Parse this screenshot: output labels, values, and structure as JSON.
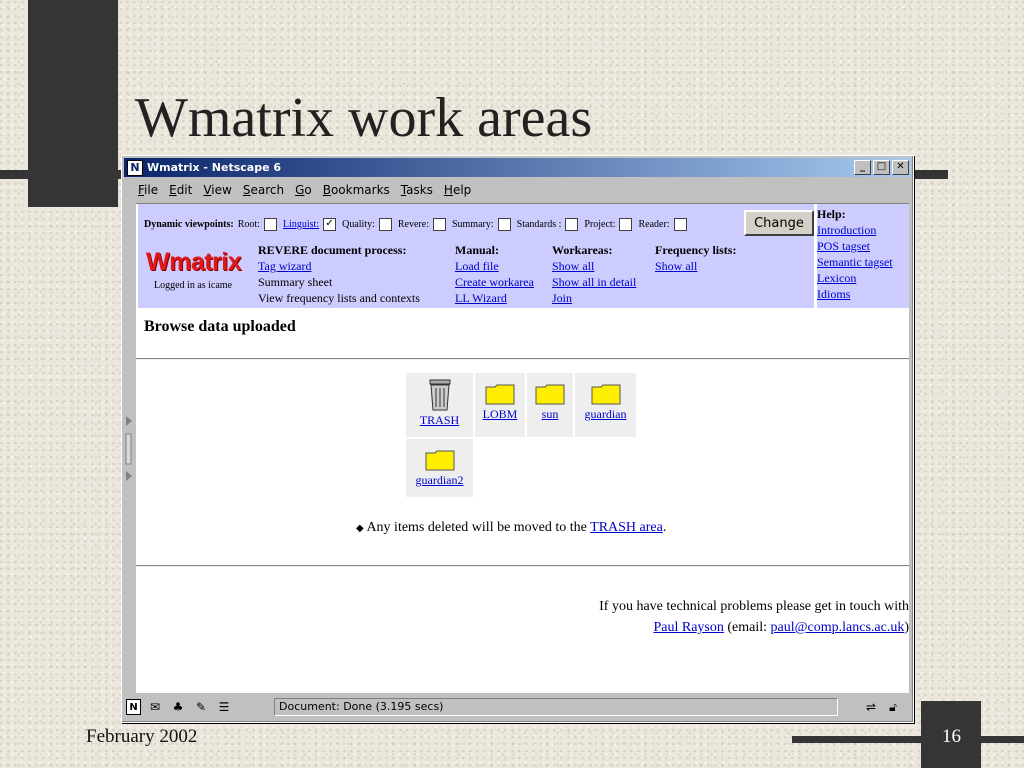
{
  "slide": {
    "title": "Wmatrix work areas",
    "date": "February 2002",
    "page_number": "16"
  },
  "window": {
    "title": "Wmatrix - Netscape 6",
    "app_icon": "N",
    "menu": [
      "File",
      "Edit",
      "View",
      "Search",
      "Go",
      "Bookmarks",
      "Tasks",
      "Help"
    ]
  },
  "header": {
    "viewpoints_label": "Dynamic viewpoints:",
    "viewpoints": [
      {
        "label": "Root:",
        "checked": false,
        "link": false
      },
      {
        "label": "Linguist:",
        "checked": true,
        "link": true
      },
      {
        "label": "Quality:",
        "checked": false,
        "link": false
      },
      {
        "label": "Revere:",
        "checked": false,
        "link": false
      },
      {
        "label": "Summary:",
        "checked": false,
        "link": false
      },
      {
        "label": "Standards :",
        "checked": false,
        "link": false
      },
      {
        "label": "Project:",
        "checked": false,
        "link": false
      },
      {
        "label": "Reader:",
        "checked": false,
        "link": false
      }
    ],
    "change_button": "Change",
    "logo": "Wmatrix",
    "logged_in": "Logged in as icame",
    "revere": {
      "heading": "REVERE document process:",
      "items": [
        "Tag wizard",
        "Summary sheet",
        "View frequency lists and contexts"
      ]
    },
    "manual": {
      "heading": "Manual:",
      "items": [
        "Load file",
        "Create workarea",
        "LL Wizard"
      ]
    },
    "workareas": {
      "heading": "Workareas:",
      "items": [
        "Show all",
        "Show all in detail",
        "Join"
      ]
    },
    "frequency": {
      "heading": "Frequency lists:",
      "items": [
        "Show all"
      ]
    },
    "help": {
      "heading": "Help:",
      "items": [
        "Introduction",
        "POS tagset",
        "Semantic tagset",
        "Lexicon",
        "Idioms"
      ]
    }
  },
  "main": {
    "title": "Browse data uploaded",
    "tiles": [
      {
        "label": "TRASH",
        "icon": "trash-icon"
      },
      {
        "label": "LOBM",
        "icon": "folder-icon"
      },
      {
        "label": "sun",
        "icon": "folder-icon"
      },
      {
        "label": "guardian",
        "icon": "folder-icon"
      },
      {
        "label": "guardian2",
        "icon": "folder-icon"
      }
    ],
    "note_prefix": "Any items deleted will be moved to the",
    "note_link": "TRASH area",
    "note_suffix": ".",
    "contact_line1": "If you have technical problems please get in touch with",
    "contact_name": "Paul Rayson",
    "contact_email_prefix": "(email:",
    "contact_email": "paul@comp.lancs.ac.uk",
    "contact_email_suffix": ")"
  },
  "status": {
    "text": "Document: Done (3.195 secs)"
  },
  "colors": {
    "header_bg": "#ccccff",
    "link": "#0000cc",
    "logo": "#e01818",
    "folder": "#ffee00"
  }
}
